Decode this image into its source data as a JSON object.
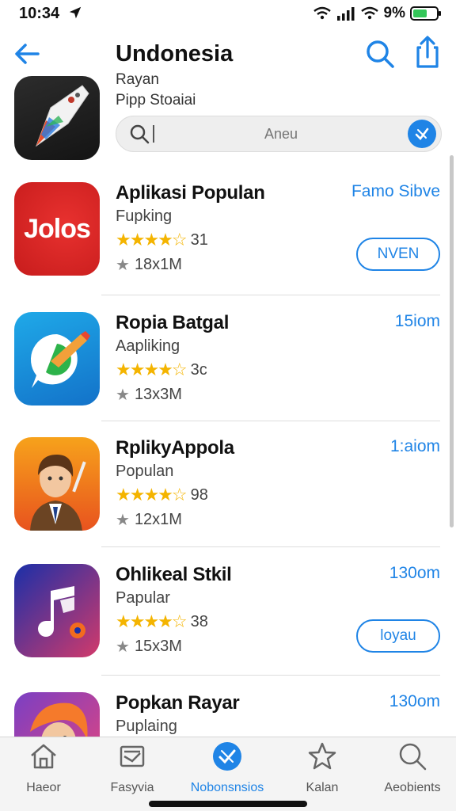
{
  "status": {
    "time": "10:34",
    "battery": "9%"
  },
  "header": {
    "title": "Undonesia"
  },
  "featured": {
    "line1": "Rayan",
    "line2": "Pipp Stoaiai"
  },
  "search": {
    "placeholder": "Aneu"
  },
  "apps": [
    {
      "name": "Aplikasi Populan",
      "category": "Fupking",
      "stars": "★★★★☆",
      "rating_count": "31",
      "size": "18x1M",
      "meta": "Famo Sibve",
      "button": "NVEN",
      "icon_text": "Jolos"
    },
    {
      "name": "Ropia Batgal",
      "category": "Aapliking",
      "stars": "★★★★☆",
      "rating_count": "3c",
      "size": "13x3M",
      "meta": "15iom",
      "button": ""
    },
    {
      "name": "RplikyAppola",
      "category": "Populan",
      "stars": "★★★★☆",
      "rating_count": "98",
      "size": "12x1M",
      "meta": "1:aiom",
      "button": ""
    },
    {
      "name": "Ohlikeal Stkil",
      "category": "Papular",
      "stars": "★★★★☆",
      "rating_count": "38",
      "size": "15x3M",
      "meta": "130om",
      "button": "loyau"
    },
    {
      "name": "Popkan Rayar",
      "category": "Puplaing",
      "meta": "130om"
    }
  ],
  "tabs": [
    {
      "label": "Haeor",
      "icon": "home-icon"
    },
    {
      "label": "Fasyvia",
      "icon": "inbox-icon"
    },
    {
      "label": "Nobonsnsios",
      "icon": "check-icon"
    },
    {
      "label": "Kalan",
      "icon": "star-icon"
    },
    {
      "label": "Aeobients",
      "icon": "search-icon"
    }
  ],
  "colors": {
    "accent": "#1f84e6",
    "star": "#f4b400"
  }
}
